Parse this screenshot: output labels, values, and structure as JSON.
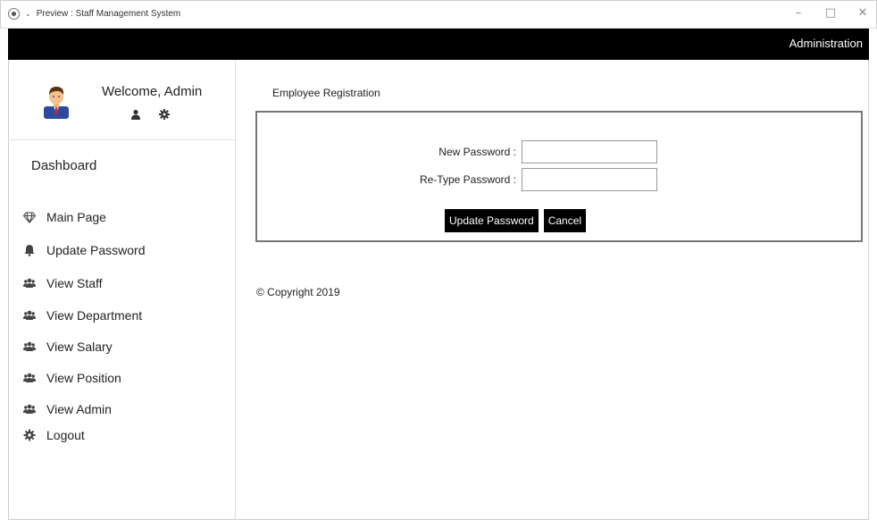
{
  "window": {
    "title": "Preview : Staff Management System",
    "controls": [
      "–",
      "□",
      "✕"
    ]
  },
  "topbar": {
    "role_label": "Administration"
  },
  "sidebar": {
    "welcome": "Welcome, Admin",
    "dashboard_label": "Dashboard",
    "items": [
      {
        "label": "Main Page",
        "icon": "diamond-icon"
      },
      {
        "label": "Update Password",
        "icon": "bell-icon"
      },
      {
        "label": "View Staff",
        "icon": "users-icon"
      },
      {
        "label": "View Department",
        "icon": "users-icon"
      },
      {
        "label": "View Salary",
        "icon": "users-icon"
      },
      {
        "label": "View Position",
        "icon": "users-icon"
      },
      {
        "label": "View Admin",
        "icon": "users-icon"
      },
      {
        "label": "Logout",
        "icon": "gear-icon"
      }
    ]
  },
  "main": {
    "page_title": "Employee Registration",
    "form": {
      "new_password_label": "New Password :",
      "new_password_value": "",
      "retype_password_label": "Re-Type Password :",
      "retype_password_value": "",
      "update_button": "Update Password",
      "cancel_button": "Cancel"
    },
    "copyright": "© Copyright 2019"
  },
  "colors": {
    "topbar_bg": "#000000",
    "button_bg": "#000000",
    "button_text": "#ffffff"
  }
}
